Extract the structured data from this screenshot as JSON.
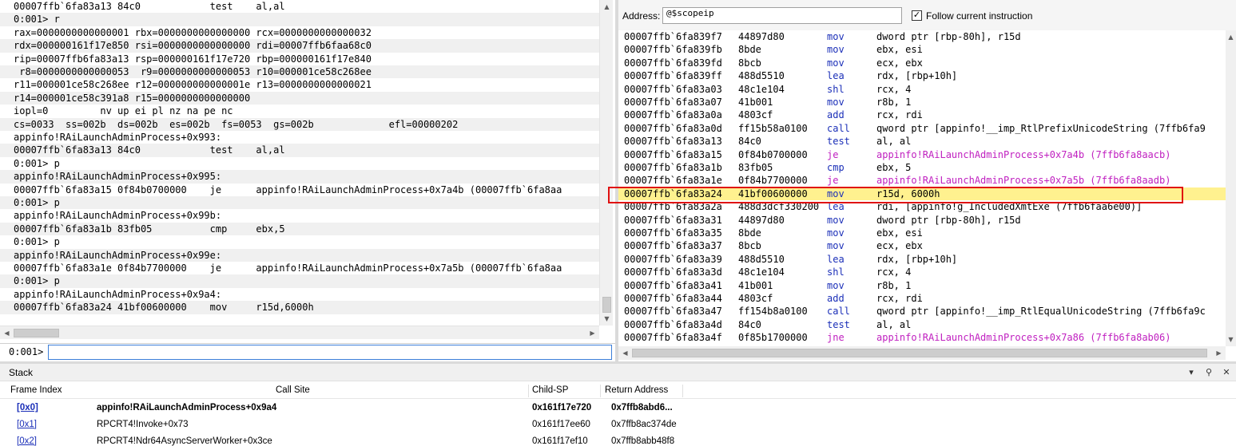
{
  "command": {
    "lines": [
      "00007ffb`6fa83a13 84c0            test    al,al",
      "0:001> r",
      "rax=0000000000000001 rbx=0000000000000000 rcx=0000000000000032",
      "rdx=000000161f17e850 rsi=0000000000000000 rdi=00007ffb6faa68c0",
      "rip=00007ffb6fa83a13 rsp=000000161f17e720 rbp=000000161f17e840",
      " r8=0000000000000053  r9=0000000000000053 r10=000001ce58c268ee",
      "r11=000001ce58c268ee r12=000000000000001e r13=0000000000000021",
      "r14=000001ce58c391a8 r15=0000000000000000",
      "iopl=0         nv up ei pl nz na pe nc",
      "cs=0033  ss=002b  ds=002b  es=002b  fs=0053  gs=002b             efl=00000202",
      "appinfo!RAiLaunchAdminProcess+0x993:",
      "00007ffb`6fa83a13 84c0            test    al,al",
      "0:001> p",
      "appinfo!RAiLaunchAdminProcess+0x995:",
      "00007ffb`6fa83a15 0f84b0700000    je      appinfo!RAiLaunchAdminProcess+0x7a4b (00007ffb`6fa8aa",
      "0:001> p",
      "appinfo!RAiLaunchAdminProcess+0x99b:",
      "00007ffb`6fa83a1b 83fb05          cmp     ebx,5",
      "0:001> p",
      "appinfo!RAiLaunchAdminProcess+0x99e:",
      "00007ffb`6fa83a1e 0f84b7700000    je      appinfo!RAiLaunchAdminProcess+0x7a5b (00007ffb`6fa8aa",
      "0:001> p",
      "appinfo!RAiLaunchAdminProcess+0x9a4:",
      "00007ffb`6fa83a24 41bf00600000    mov     r15d,6000h"
    ],
    "prompt": "0:001>",
    "input_value": ""
  },
  "disassembly": {
    "address_label": "Address:",
    "address_value": "@$scopeip",
    "follow_label": "Follow current instruction",
    "follow_checked": "✓",
    "rows": [
      {
        "addr": "00007ffb`6fa839f7",
        "bytes": "44897d80",
        "mn": "mov",
        "op": "dword ptr [rbp-80h], r15d"
      },
      {
        "addr": "00007ffb`6fa839fb",
        "bytes": "8bde",
        "mn": "mov",
        "op": "ebx, esi"
      },
      {
        "addr": "00007ffb`6fa839fd",
        "bytes": "8bcb",
        "mn": "mov",
        "op": "ecx, ebx"
      },
      {
        "addr": "00007ffb`6fa839ff",
        "bytes": "488d5510",
        "mn": "lea",
        "op": "rdx, [rbp+10h]"
      },
      {
        "addr": "00007ffb`6fa83a03",
        "bytes": "48c1e104",
        "mn": "shl",
        "op": "rcx, 4"
      },
      {
        "addr": "00007ffb`6fa83a07",
        "bytes": "41b001",
        "mn": "mov",
        "op": "r8b, 1"
      },
      {
        "addr": "00007ffb`6fa83a0a",
        "bytes": "4803cf",
        "mn": "add",
        "op": "rcx, rdi"
      },
      {
        "addr": "00007ffb`6fa83a0d",
        "bytes": "ff15b58a0100",
        "mn": "call",
        "op": "qword ptr [appinfo!__imp_RtlPrefixUnicodeString (7ffb6fa9"
      },
      {
        "addr": "00007ffb`6fa83a13",
        "bytes": "84c0",
        "mn": "test",
        "op": "al, al"
      },
      {
        "addr": "00007ffb`6fa83a15",
        "bytes": "0f84b0700000",
        "mn": "je",
        "op": "appinfo!RAiLaunchAdminProcess+0x7a4b (7ffb6fa8aacb)",
        "branch": true
      },
      {
        "addr": "00007ffb`6fa83a1b",
        "bytes": "83fb05",
        "mn": "cmp",
        "op": "ebx, 5"
      },
      {
        "addr": "00007ffb`6fa83a1e",
        "bytes": "0f84b7700000",
        "mn": "je",
        "op": "appinfo!RAiLaunchAdminProcess+0x7a5b (7ffb6fa8aadb)",
        "branch": true
      },
      {
        "addr": "00007ffb`6fa83a24",
        "bytes": "41bf00600000",
        "mn": "mov",
        "op": "r15d, 6000h",
        "current": true
      },
      {
        "addr": "00007ffb`6fa83a2a",
        "bytes": "488d3dcf330200",
        "mn": "lea",
        "op": "rdi, [appinfo!g_IncludedXmtExe (7ffb6faa6e00)]"
      },
      {
        "addr": "00007ffb`6fa83a31",
        "bytes": "44897d80",
        "mn": "mov",
        "op": "dword ptr [rbp-80h], r15d"
      },
      {
        "addr": "00007ffb`6fa83a35",
        "bytes": "8bde",
        "mn": "mov",
        "op": "ebx, esi"
      },
      {
        "addr": "00007ffb`6fa83a37",
        "bytes": "8bcb",
        "mn": "mov",
        "op": "ecx, ebx"
      },
      {
        "addr": "00007ffb`6fa83a39",
        "bytes": "488d5510",
        "mn": "lea",
        "op": "rdx, [rbp+10h]"
      },
      {
        "addr": "00007ffb`6fa83a3d",
        "bytes": "48c1e104",
        "mn": "shl",
        "op": "rcx, 4"
      },
      {
        "addr": "00007ffb`6fa83a41",
        "bytes": "41b001",
        "mn": "mov",
        "op": "r8b, 1"
      },
      {
        "addr": "00007ffb`6fa83a44",
        "bytes": "4803cf",
        "mn": "add",
        "op": "rcx, rdi"
      },
      {
        "addr": "00007ffb`6fa83a47",
        "bytes": "ff154b8a0100",
        "mn": "call",
        "op": "qword ptr [appinfo!__imp_RtlEqualUnicodeString (7ffb6fa9c"
      },
      {
        "addr": "00007ffb`6fa83a4d",
        "bytes": "84c0",
        "mn": "test",
        "op": "al, al"
      },
      {
        "addr": "00007ffb`6fa83a4f",
        "bytes": "0f85b1700000",
        "mn": "jne",
        "op": "appinfo!RAiLaunchAdminProcess+0x7a86 (7ffb6fa8ab06)",
        "branch": true
      }
    ]
  },
  "stack": {
    "title": "Stack",
    "columns": [
      "Frame Index",
      "Call Site",
      "Child-SP",
      "Return Address"
    ],
    "rows": [
      {
        "index": "[0x0]",
        "site": "appinfo!RAiLaunchAdminProcess+0x9a4",
        "sp": "0x161f17e720",
        "ret": "0x7ffb8abd6..."
      },
      {
        "index": "[0x1]",
        "site": "RPCRT4!Invoke+0x73",
        "sp": "0x161f17ee60",
        "ret": "0x7ffb8ac374de"
      },
      {
        "index": "[0x2]",
        "site": "RPCRT4!Ndr64AsyncServerWorker+0x3ce",
        "sp": "0x161f17ef10",
        "ret": "0x7ffb8abb48f8"
      }
    ]
  },
  "icons": {
    "scroll_up": "up-arrow",
    "scroll_down": "down-arrow",
    "scroll_left": "left-arrow",
    "scroll_right": "right-arrow",
    "checkbox": "check-icon",
    "pane_menu": "chevron-down-icon",
    "pin": "pin-icon",
    "close": "close-icon"
  },
  "colors": {
    "mnemonic": "#1b2fb8",
    "branch": "#c020c0",
    "current_line": "#fff18f",
    "highlight_box": "#e01010",
    "link": "#1b2fb8"
  }
}
